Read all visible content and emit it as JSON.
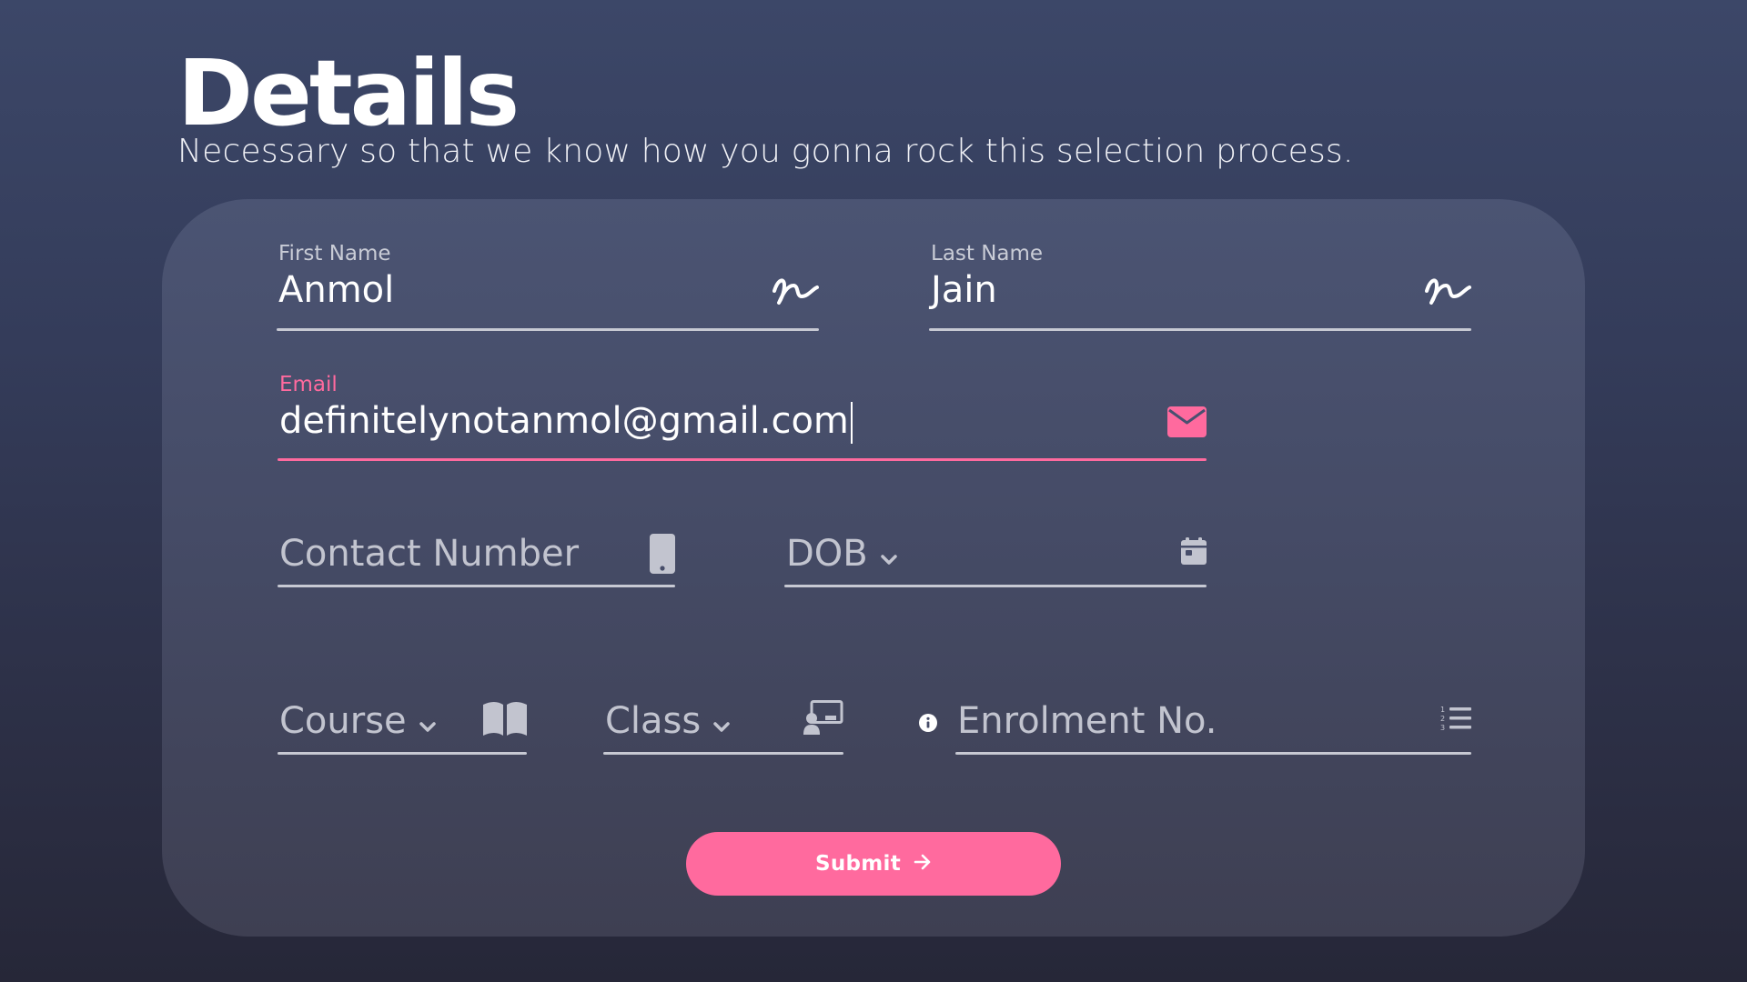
{
  "header": {
    "title": "Details",
    "subtitle": "Necessary so that we know how you gonna rock this selection process."
  },
  "form": {
    "first_name": {
      "label": "First Name",
      "value": "Anmol",
      "icon": "signature-icon"
    },
    "last_name": {
      "label": "Last Name",
      "value": "Jain",
      "icon": "signature-icon"
    },
    "email": {
      "label": "Email",
      "value": "definitelynotanmol@gmail.com",
      "icon": "envelope-icon",
      "focused": true
    },
    "contact": {
      "placeholder": "Contact Number",
      "icon": "mobile-phone-icon"
    },
    "dob": {
      "placeholder": "DOB",
      "icon": "calendar-icon"
    },
    "course": {
      "placeholder": "Course",
      "icon": "book-icon"
    },
    "class": {
      "placeholder": "Class",
      "icon": "teacher-board-icon"
    },
    "enrolment": {
      "placeholder": "Enrolment No.",
      "icon": "numbered-list-icon",
      "info_icon": "info-icon"
    },
    "submit_label": "Submit"
  },
  "colors": {
    "accent": "#ff6a9e",
    "card": "#484f6c",
    "background": "#2c2f45",
    "line": "#c7c9d3"
  }
}
